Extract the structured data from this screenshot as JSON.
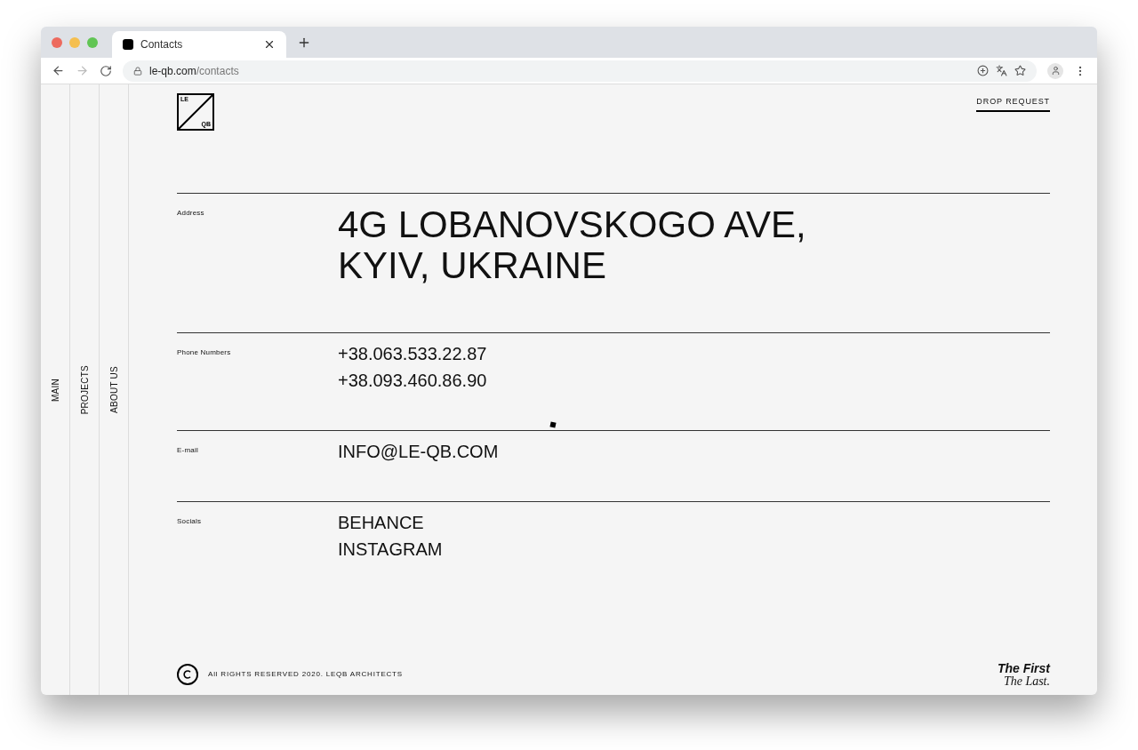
{
  "browser": {
    "tab_title": "Contacts",
    "url_host": "le-qb.com",
    "url_path": "/contacts"
  },
  "logo": {
    "top": "LE",
    "bottom": "QB"
  },
  "header": {
    "cta": "DROP REQUEST"
  },
  "side_nav": [
    "MAIN",
    "PROJECTS",
    "ABOUT US"
  ],
  "sections": [
    {
      "label": "Address",
      "kind": "large",
      "lines": [
        "4G LOBANOVSKOGO AVE,",
        "KYIV, UKRAINE"
      ]
    },
    {
      "label": "Phone Numbers",
      "kind": "medium",
      "lines": [
        "+38.063.533.22.87",
        "+38.093.460.86.90"
      ]
    },
    {
      "label": "E-mail",
      "kind": "medium",
      "lines": [
        "INFO@LE-QB.COM"
      ]
    },
    {
      "label": "Socials",
      "kind": "medium",
      "lines": [
        "BEHANCE",
        "INSTAGRAM"
      ]
    }
  ],
  "footer": {
    "copyright": "All RIGHTS RESERVED 2020. LEQB ARCHITECTS",
    "tagline_1": "The First",
    "tagline_2": "The Last."
  }
}
